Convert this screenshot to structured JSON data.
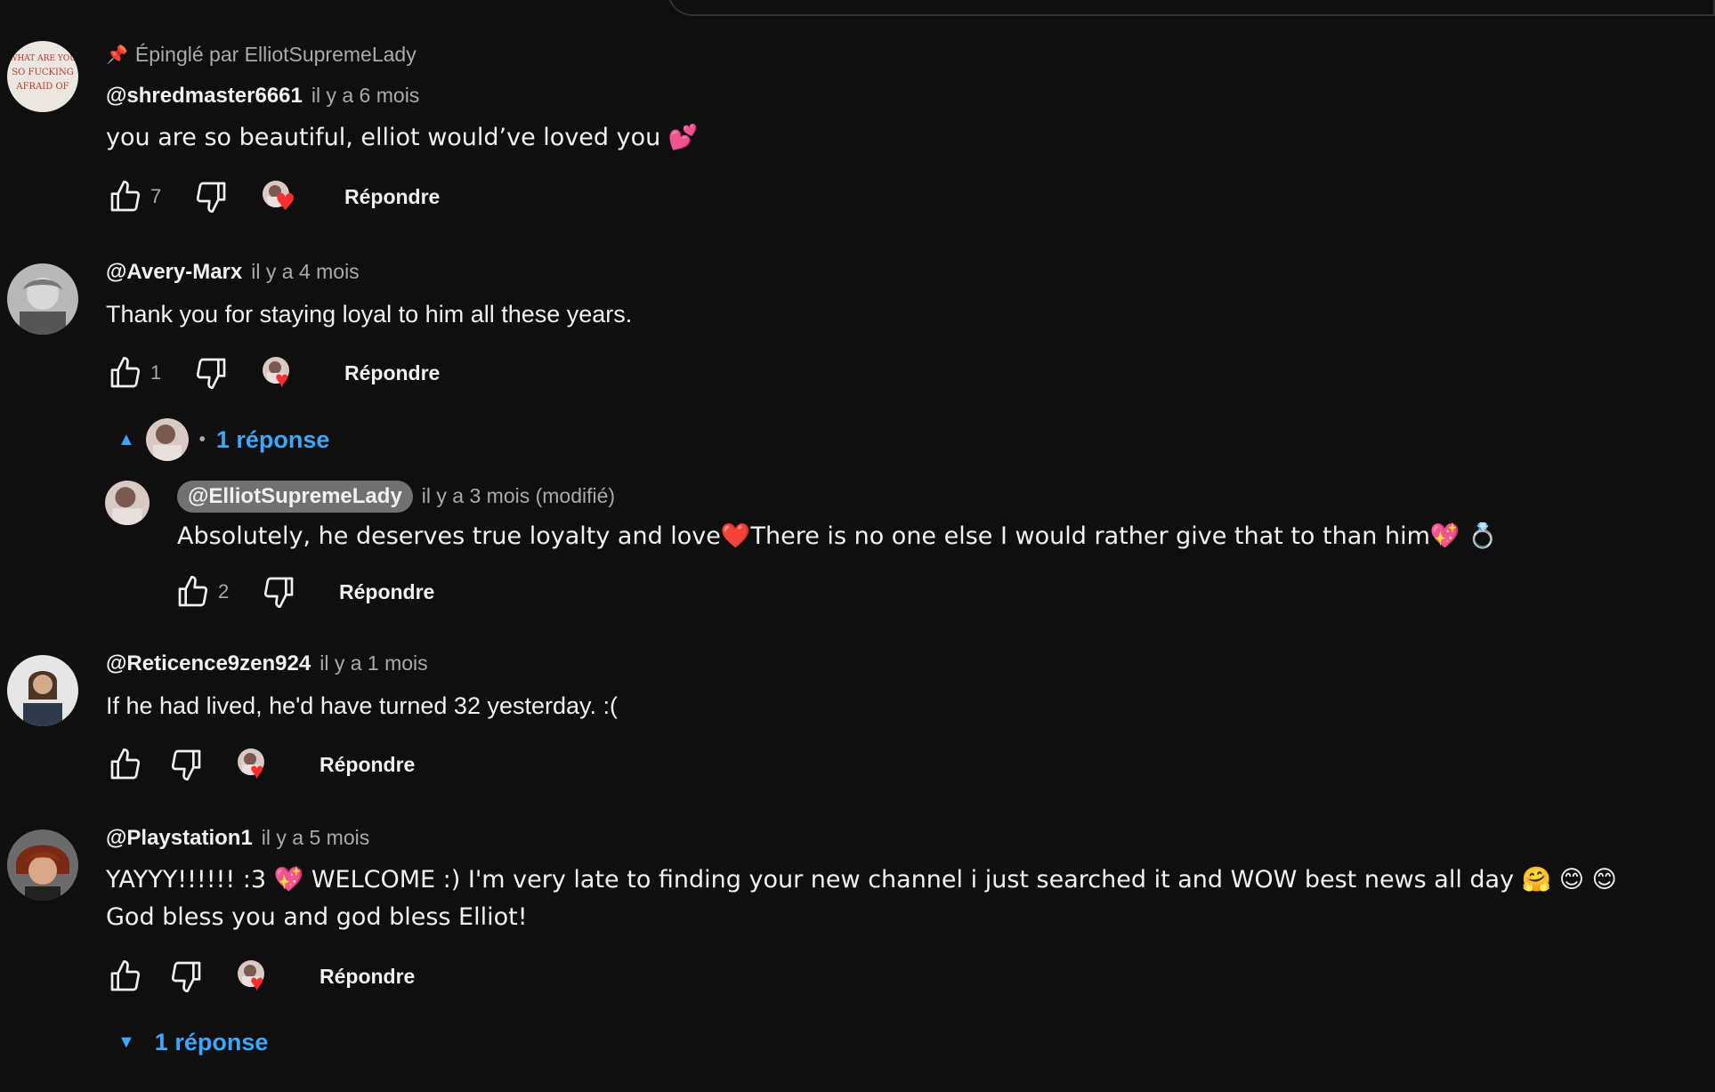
{
  "pinned_label": "Épinglé par ElliotSupremeLady",
  "comments": [
    {
      "author": "@shredmaster6661",
      "time": "il y a 6 mois",
      "text": "you are so beautiful, elliot would’ve loved you 💕",
      "likes": "7",
      "reply_label": "Répondre",
      "avatar_text": "WHAT ARE YOU SO FUCKING AFRAID OF"
    },
    {
      "author": "@Avery-Marx",
      "time": "il y a 4 mois",
      "text": "Thank you for staying loyal to him all these years.",
      "likes": "1",
      "reply_label": "Répondre",
      "replies_toggle": "1 réponse"
    },
    {
      "author": "@Reticence9zen924",
      "time": "il y a 1 mois",
      "text": "If he had lived, he'd have turned 32 yesterday. :(",
      "likes": "",
      "reply_label": "Répondre"
    },
    {
      "author": "@Playstation1",
      "time": "il y a 5 mois",
      "text": "YAYYY!!!!!! :3 💖 WELCOME :) I'm very late to finding your new channel i just searched it and WOW best news all day 🤗 😊 😊 God bless you and god bless Elliot!",
      "likes": "",
      "reply_label": "Répondre",
      "replies_toggle": "1 réponse"
    }
  ],
  "reply": {
    "author": "@ElliotSupremeLady",
    "time": "il y a 3 mois (modifié)",
    "text": "Absolutely, he deserves true loyalty and love❤️There is no one else I would rather give that to than him💖 💍",
    "likes": "2",
    "reply_label": "Répondre"
  },
  "colors": {
    "background": "#0f0f0f",
    "link": "#3ea6ff",
    "heart": "#ff2d2d",
    "secondary_text": "#aaaaaa"
  }
}
